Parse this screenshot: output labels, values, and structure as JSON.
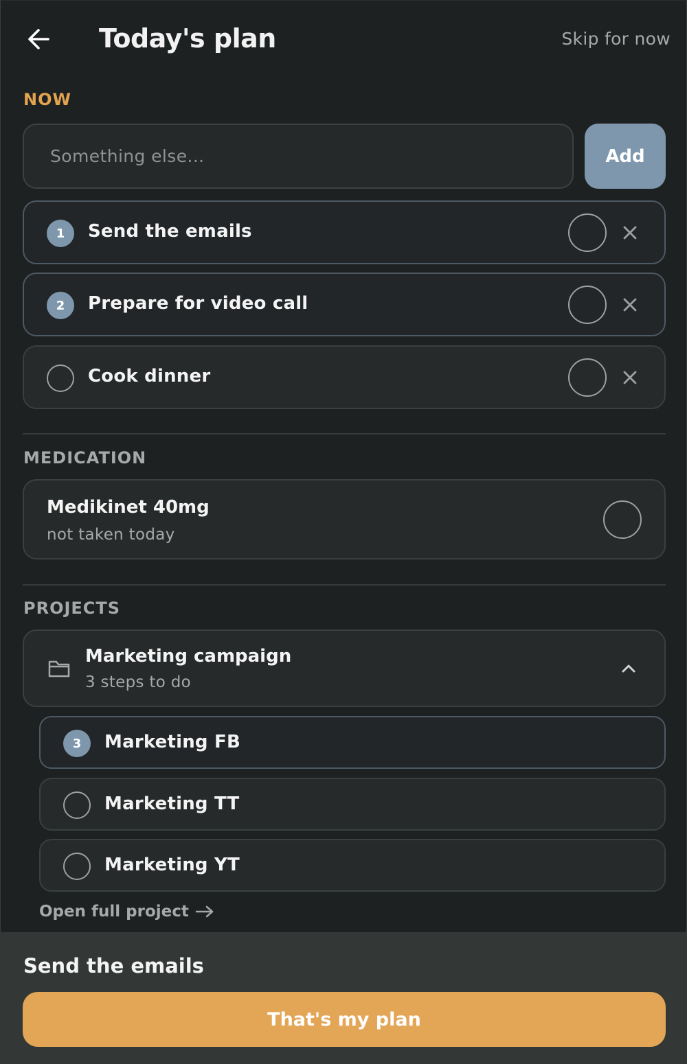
{
  "header": {
    "title": "Today's plan",
    "skip_label": "Skip for now",
    "back_icon": "arrow-left-icon"
  },
  "now": {
    "label": "NOW",
    "input_placeholder": "Something else...",
    "input_value": "",
    "add_label": "Add",
    "tasks": [
      {
        "rank": "1",
        "label": "Send the emails"
      },
      {
        "rank": "2",
        "label": "Prepare for video call"
      },
      {
        "rank": "",
        "label": "Cook dinner"
      }
    ]
  },
  "medication": {
    "label": "MEDICATION",
    "name": "Medikinet 40mg",
    "status": "not taken today"
  },
  "projects": {
    "label": "PROJECTS",
    "project": {
      "name": "Marketing campaign",
      "steps_text": "3 steps to do",
      "expanded": true
    },
    "steps": [
      {
        "rank": "3",
        "label": "Marketing FB"
      },
      {
        "rank": "",
        "label": "Marketing TT"
      },
      {
        "rank": "",
        "label": "Marketing YT"
      }
    ],
    "open_label": "Open full project"
  },
  "footer": {
    "current_task": "Send the emails",
    "confirm_label": "That's my plan"
  },
  "colors": {
    "background": "#1e2122",
    "accent": "#e3a656",
    "rank_badge": "#7f97ad",
    "footer_bg": "#333837"
  }
}
